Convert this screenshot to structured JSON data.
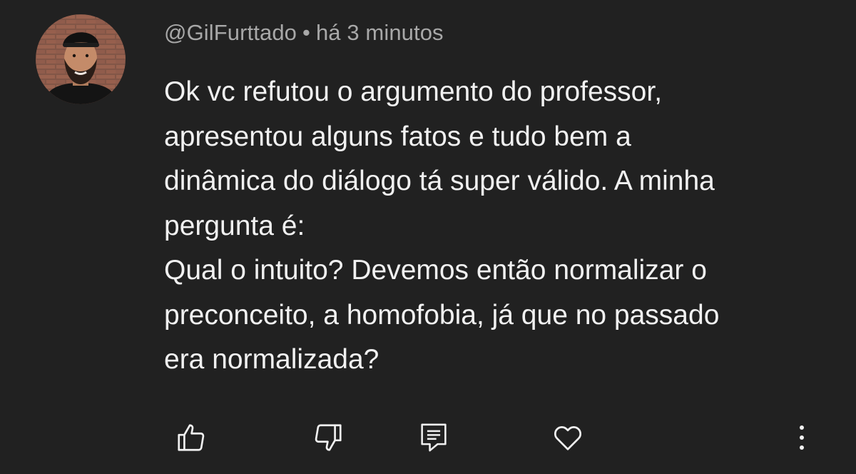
{
  "comment": {
    "username": "@GilFurttado",
    "separator": "•",
    "timestamp": "há 3 minutos",
    "text_lines": [
      "Ok vc refutou o argumento do professor,",
      "apresentou alguns fatos e tudo bem a",
      "dinâmica do diálogo tá super válido. A minha",
      "pergunta é:",
      "Qual o intuito? Devemos então normalizar o",
      "preconceito, a homofobia, já que no passado",
      "era normalizada?"
    ]
  },
  "actions": [
    {
      "icon": "thumbs-up-icon"
    },
    {
      "icon": "thumbs-down-icon"
    },
    {
      "icon": "reply-icon"
    },
    {
      "icon": "heart-icon"
    },
    {
      "icon": "more-options-icon"
    }
  ],
  "colors": {
    "background": "#212121",
    "username": "#a8a8a8",
    "text": "#f1f1f1",
    "icon": "#f1f1f1"
  }
}
